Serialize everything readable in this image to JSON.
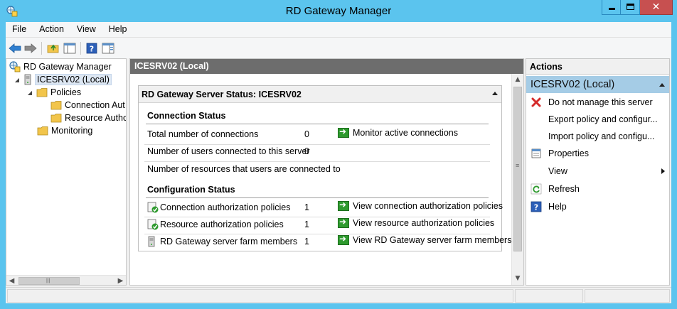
{
  "window": {
    "title": "RD Gateway Manager",
    "close_glyph": "✕"
  },
  "menu": [
    "File",
    "Action",
    "View",
    "Help"
  ],
  "toolbar": {
    "buttons": [
      "back-icon",
      "forward-icon",
      "up-folder-icon",
      "show-hide-console-tree-icon",
      "help-icon",
      "show-hide-action-pane-icon"
    ]
  },
  "tree": {
    "root": "RD Gateway Manager",
    "server": "ICESRV02 (Local)",
    "policies": "Policies",
    "connection_auth": "Connection Aut",
    "resource_auth": "Resource Autho",
    "monitoring": "Monitoring"
  },
  "center": {
    "header": "ICESRV02 (Local)",
    "status_title": "RD Gateway Server Status: ICESRV02",
    "connection_status": {
      "title": "Connection Status",
      "rows": [
        {
          "label": "Total number of connections",
          "value": "0",
          "action": "Monitor active connections"
        },
        {
          "label": "Number of users connected to this server",
          "value": "0"
        },
        {
          "label": "Number of resources that users are connected to",
          "value": ""
        }
      ]
    },
    "configuration_status": {
      "title": "Configuration Status",
      "rows": [
        {
          "label": "Connection authorization policies",
          "value": "1",
          "action": "View connection authorization policies"
        },
        {
          "label": "Resource authorization policies",
          "value": "1",
          "action": "View resource authorization policies"
        },
        {
          "label": "RD Gateway server farm members",
          "value": "1",
          "action": "View RD Gateway server farm members"
        }
      ]
    }
  },
  "actions": {
    "header": "Actions",
    "section": "ICESRV02 (Local)",
    "items": [
      {
        "label": "Do not manage this server",
        "icon": "red-x-icon"
      },
      {
        "label": "Export policy and configur...",
        "icon": ""
      },
      {
        "label": "Import policy and configu...",
        "icon": ""
      },
      {
        "label": "Properties",
        "icon": "properties-icon"
      },
      {
        "label": "View",
        "icon": ""
      },
      {
        "label": "Refresh",
        "icon": "refresh-icon"
      },
      {
        "label": "Help",
        "icon": "help-icon"
      }
    ]
  },
  "colors": {
    "titlebar": "#5bc4ee",
    "close_button": "#c75050",
    "center_header": "#6d6d6d",
    "actions_selected": "#a5cce6",
    "green_action": "#2e9a2e"
  }
}
